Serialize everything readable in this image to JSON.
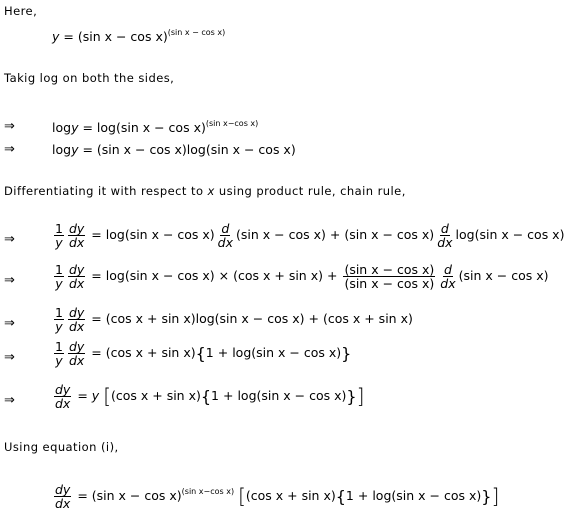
{
  "intro": {
    "here": "Here,",
    "taking_log": "Takig  log  on  both  the  sides,",
    "differentiating": "Differentiating it with respect to",
    "diff_var": "x",
    "diff_rest": "using product rule, chain rule,",
    "using_eq": "Using  equation  (i),",
    "arrow": "⇒"
  },
  "eq": {
    "y": "y",
    "eq": "=",
    "base": "(sin x − cos x)",
    "exp": "(sin x − cos x)",
    "exp2": "(sin x−cos x)",
    "log": "log",
    "sin_cos": "(sin x − cos x)",
    "cos_sin": "(cos x + sin x)",
    "one": "1",
    "d": "d",
    "dx": "dx",
    "dy": "dy",
    "plus": "+",
    "times": "×"
  }
}
